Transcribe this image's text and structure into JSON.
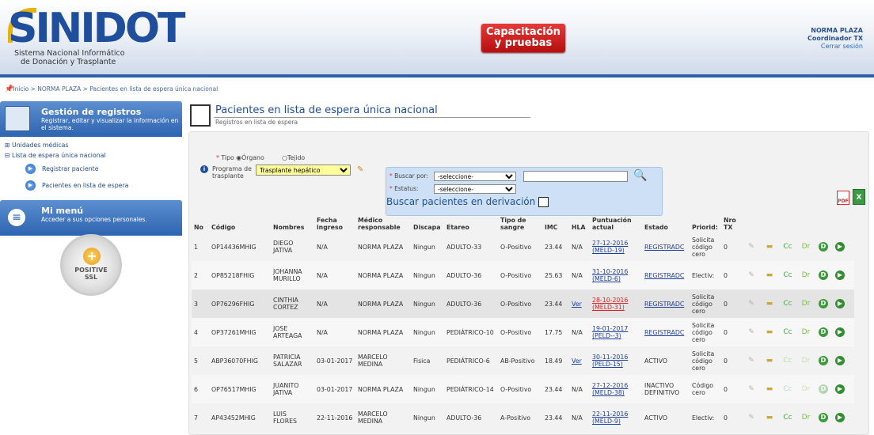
{
  "header": {
    "logo_text": "SINIDOT",
    "logo_sub1": "Sistema Nacional Informático",
    "logo_sub2": "de Donación y Trasplante",
    "env_label_1": "Capacitación",
    "env_label_2": "y pruebas",
    "user_name": "NORMA PLAZA",
    "user_role": "Coordinador TX",
    "logout": "Cerrar sesión"
  },
  "breadcrumb": "Inicio > NORMA PLAZA > Pacientes en lista de espera única nacional",
  "sidebar": {
    "panel1_title": "Gestión de registros",
    "panel1_desc": "Registrar, editar y visualizar la información en el sistema.",
    "tree": {
      "unidades": "⊞ Unidades médicas",
      "lista": "⊟ Lista de espera única nacional",
      "registrar": "Registrar paciente",
      "pacientes": "Pacientes en lista de espera"
    },
    "panel2_title": "Mi menú",
    "panel2_desc": "Acceder a sus opciones personales.",
    "ssl_text": "POSITIVE",
    "ssl_text2": "SSL"
  },
  "page": {
    "title": "Pacientes en lista de espera única nacional",
    "subtitle": "Registros en lista de espera"
  },
  "filters": {
    "tipo_label": "Tipo",
    "organo": "Órgano",
    "tejido": "Tejido",
    "programa_label": "Programa de trasplante",
    "programa_value": "Trasplante hepático",
    "buscar_por": "Buscar por:",
    "estatus": "Estatus:",
    "select_placeholder": "-seleccione-",
    "derivacion": "Buscar pacientes en derivación"
  },
  "table": {
    "headers": [
      "No",
      "Código",
      "Nombres",
      "Fecha ingreso",
      "Médico responsable",
      "Discapa",
      "Etareo",
      "Tipo de sangre",
      "IMC",
      "HLA",
      "Puntuación actual",
      "Estado",
      "Priorid:",
      "Nro TX"
    ],
    "rows": [
      {
        "no": "1",
        "codigo": "OP14436MHIG",
        "nombres": "DIEGO JATIVA",
        "fecha": "N/A",
        "medico": "NORMA PLAZA",
        "discap": "Ningun",
        "etareo": "ADULTO-33",
        "sangre": "O-Positivo",
        "imc": "23.44",
        "hla": "N/A",
        "punt": "27-12-2016 (MELD-19)",
        "punt_red": false,
        "estado": "REGISTRADC",
        "estado_link": true,
        "prior": "Solicita código cero",
        "nro": "0",
        "acts_dim": false,
        "shade": false
      },
      {
        "no": "2",
        "codigo": "OP85218FHIG",
        "nombres": "JOHANNA MURILLO",
        "fecha": "N/A",
        "medico": "NORMA PLAZA",
        "discap": "Ningun",
        "etareo": "ADULTO-36",
        "sangre": "O-Positivo",
        "imc": "25.63",
        "hla": "N/A",
        "punt": "31-10-2016 (MELD-6)",
        "punt_red": false,
        "estado": "REGISTRADC",
        "estado_link": true,
        "prior": "Electiv:",
        "nro": "0",
        "acts_dim": false,
        "shade": false
      },
      {
        "no": "3",
        "codigo": "OP76296FHIG",
        "nombres": "CINTHIA CORTEZ",
        "fecha": "N/A",
        "medico": "NORMA PLAZA",
        "discap": "Ningun",
        "etareo": "ADULTO-36",
        "sangre": "O-Positivo",
        "imc": "23.44",
        "hla": "Ver",
        "punt": "28-10-2016 (MELD-31)",
        "punt_red": true,
        "estado": "REGISTRADC",
        "estado_link": true,
        "prior": "Solicita código cero",
        "nro": "0",
        "acts_dim": false,
        "shade": true
      },
      {
        "no": "4",
        "codigo": "OP37261MHIG",
        "nombres": "JOSE ARTEAGA",
        "fecha": "N/A",
        "medico": "NORMA PLAZA",
        "discap": "Ningun",
        "etareo": "PEDIÁTRICO-10",
        "sangre": "O-Positivo",
        "imc": "17.75",
        "hla": "N/A",
        "punt": "19-01-2017 (PELD--3)",
        "punt_red": false,
        "estado": "REGISTRADC",
        "estado_link": true,
        "prior": "Solicita código cero",
        "nro": "0",
        "acts_dim": false,
        "shade": false
      },
      {
        "no": "5",
        "codigo": "ABP36070FHIG",
        "nombres": "PATRICIA SALAZAR",
        "fecha": "03-01-2017",
        "medico": "MARCELO MEDINA",
        "discap": "Fisica",
        "etareo": "PEDIÁTRICO-6",
        "sangre": "AB-Positivo",
        "imc": "18.49",
        "hla": "Ver",
        "punt": "30-11-2016 (PELD-15)",
        "punt_red": false,
        "estado": "ACTIVO",
        "estado_link": false,
        "prior": "Solicita código cero",
        "nro": "0",
        "acts_dim": true,
        "shade": false
      },
      {
        "no": "6",
        "codigo": "OP76517MHIG",
        "nombres": "JUANITO JATIVA",
        "fecha": "03-01-2017",
        "medico": "NORMA PLAZA",
        "discap": "Ningun",
        "etareo": "PEDIÁTRICO-14",
        "sangre": "O-Positivo",
        "imc": "23.44",
        "hla": "N/A",
        "punt": "27-12-2016 (MELD-38)",
        "punt_red": false,
        "estado": "INACTIVO DEFINITIVO",
        "estado_link": false,
        "prior": "Código cero",
        "nro": "0",
        "acts_dim": true,
        "shade": false
      },
      {
        "no": "7",
        "codigo": "AP43452MHIG",
        "nombres": "LUIS FLORES",
        "fecha": "22-11-2016",
        "medico": "MARCELO MEDINA",
        "discap": "Ningun",
        "etareo": "ADULTO-36",
        "sangre": "A-Positivo",
        "imc": "23.44",
        "hla": "N/A",
        "punt": "22-11-2016 (MELD-9)",
        "punt_red": false,
        "estado": "ACTIVO",
        "estado_link": false,
        "prior": "Electiv:",
        "nro": "0",
        "acts_dim": false,
        "shade": false
      }
    ]
  }
}
